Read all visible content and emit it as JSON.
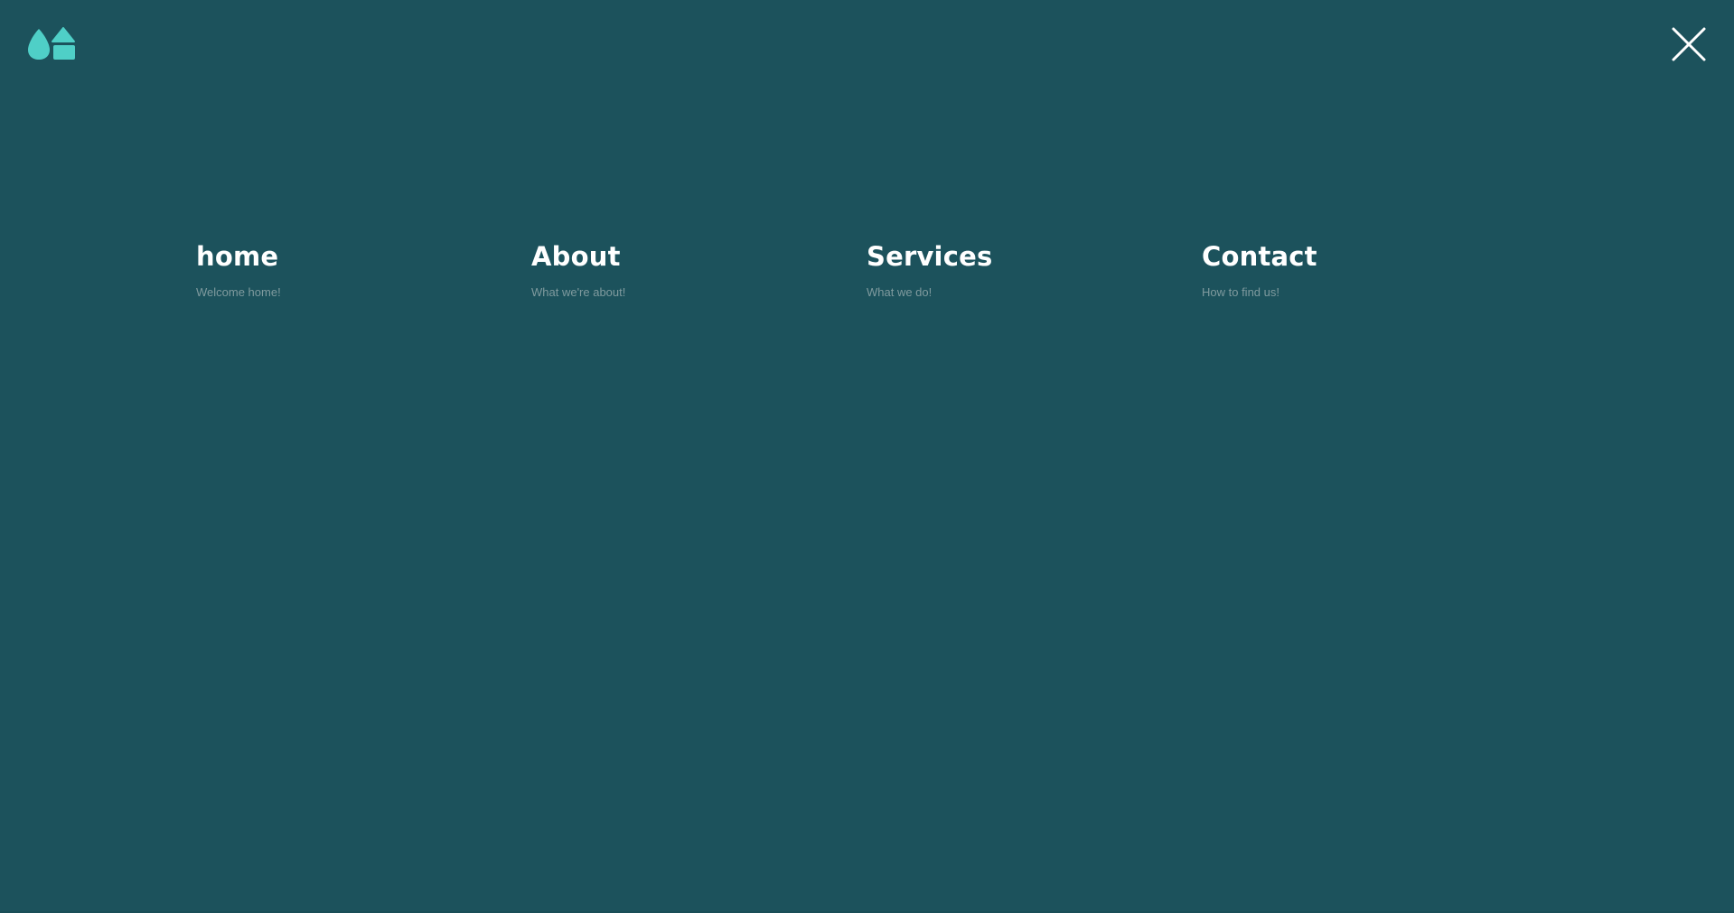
{
  "colors": {
    "background": "#1c525c",
    "accent": "#4fcfc7",
    "title": "#ffffff",
    "subtitle": "#7f9a9e"
  },
  "header": {
    "logo_icon": "brand-logo-icon",
    "close_icon": "close-icon"
  },
  "nav": {
    "items": [
      {
        "title": "home",
        "subtitle": "Welcome home!"
      },
      {
        "title": "About",
        "subtitle": "What we're about!"
      },
      {
        "title": "Services",
        "subtitle": "What we do!"
      },
      {
        "title": "Contact",
        "subtitle": "How to find us!"
      }
    ]
  }
}
